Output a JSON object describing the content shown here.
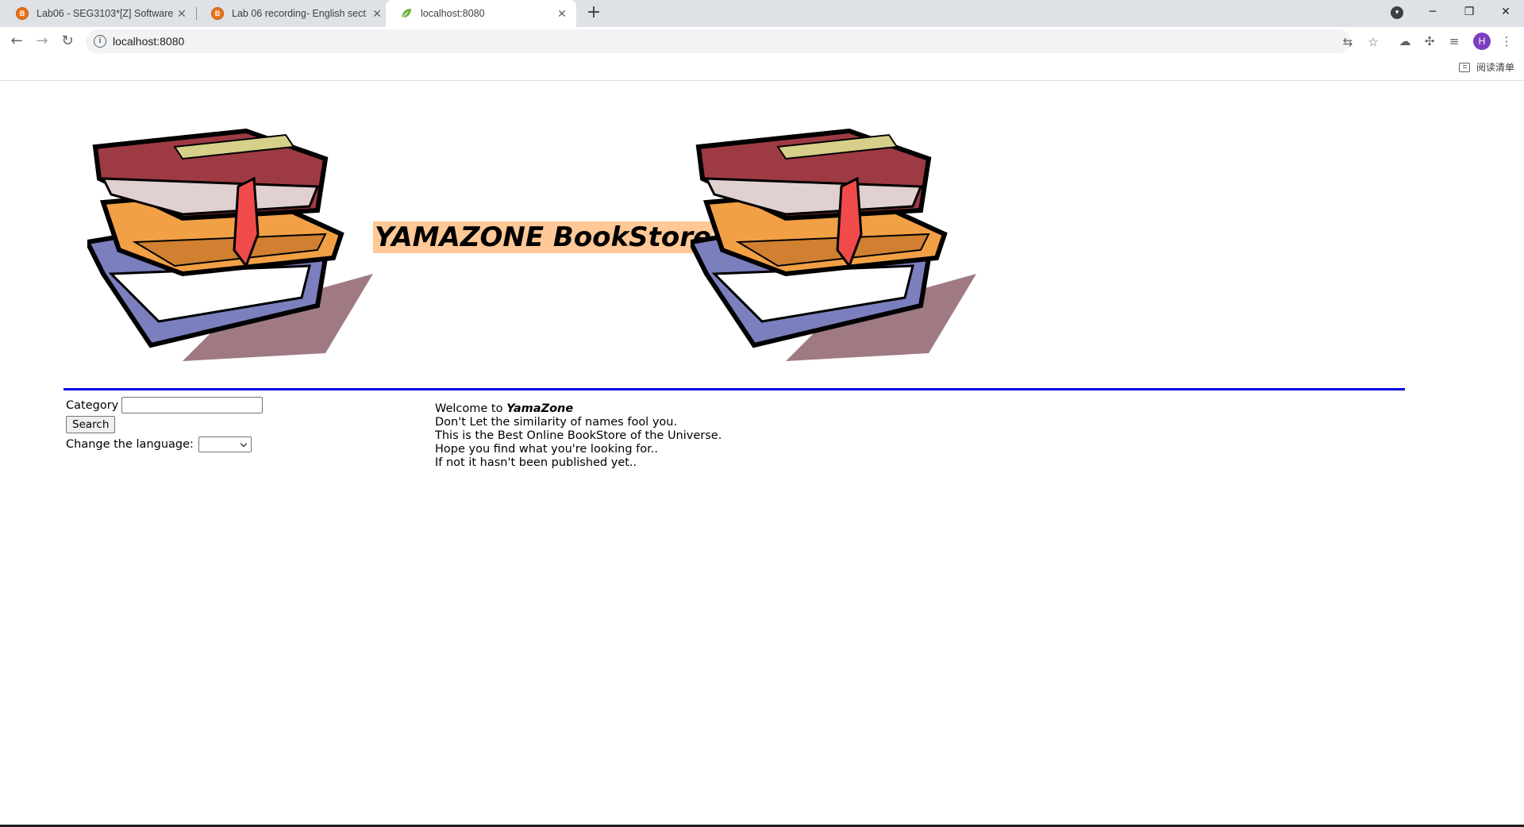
{
  "browser": {
    "tabs": [
      {
        "title": "Lab06 - SEG3103*[Z] Software",
        "state": "inactive",
        "favicon": "blog-icon"
      },
      {
        "title": "Lab 06 recording- English sect",
        "state": "inactive",
        "favicon": "blog-icon"
      },
      {
        "title": "localhost:8080",
        "state": "active",
        "favicon": "leaf-icon"
      }
    ],
    "url": "localhost:8080",
    "avatar_initial": "H",
    "reading_list_label": "阅读清单"
  },
  "page": {
    "title": "YAMAZONE BookStore",
    "category_label": "Category",
    "category_value": "",
    "search_button": "Search",
    "language_label": "Change the language:",
    "language_selected": "",
    "welcome": {
      "intro": "Welcome to ",
      "brand": "YamaZone",
      "lines": [
        "Don't Let the similarity of names fool you.",
        "This is the Best Online BookStore of the Universe.",
        "Hope you find what you're looking for..",
        "If not it hasn't been published yet.."
      ]
    }
  },
  "colors": {
    "title_highlight": "#ffc896",
    "rule": "#0000e0",
    "tab_strip": "#dee1e6"
  }
}
